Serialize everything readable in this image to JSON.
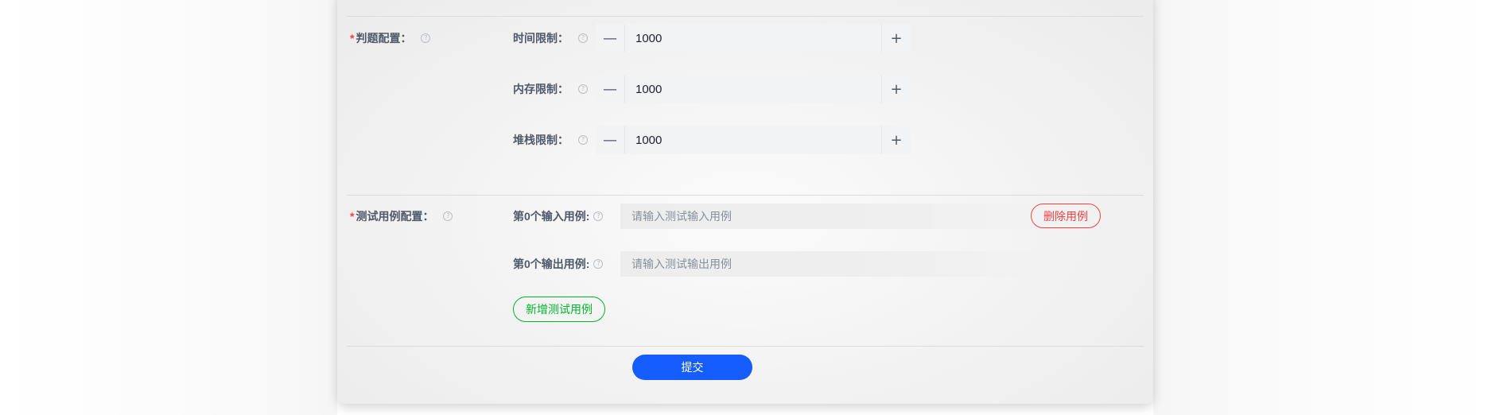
{
  "judge_config": {
    "label": "判题配置：",
    "fields": [
      {
        "label": "时间限制：",
        "value": "1000"
      },
      {
        "label": "内存限制：",
        "value": "1000"
      },
      {
        "label": "堆栈限制：",
        "value": "1000"
      }
    ],
    "minus_glyph": "—",
    "plus_glyph": "+"
  },
  "test_case_config": {
    "label": "测试用例配置：",
    "cases": [
      {
        "input_label": "第0个输入用例:",
        "input_placeholder": "请输入测试输入用例",
        "input_value": "",
        "output_label": "第0个输出用例:",
        "output_placeholder": "请输入测试输出用例",
        "output_value": "",
        "delete_label": "删除用例"
      }
    ],
    "add_label": "新增测试用例"
  },
  "submit_label": "提交",
  "required_mark": "*",
  "help_glyph": "?",
  "colors": {
    "primary": "#165dff",
    "danger": "#f53f3f",
    "success": "#00b42a",
    "label": "#4e5969",
    "input_bg": "#f2f3f5"
  }
}
